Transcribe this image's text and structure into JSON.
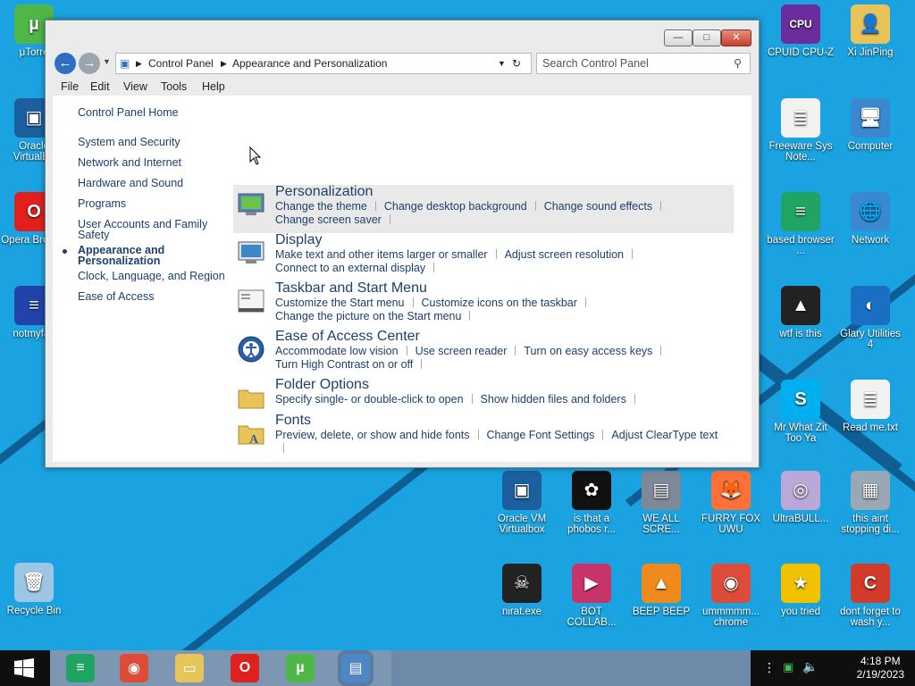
{
  "colors": {
    "accent": "#1aa3e0",
    "link": "#1d3f6e"
  },
  "window": {
    "buttons": {
      "minimize": "—",
      "maximize": "□",
      "close": "✕"
    },
    "breadcrumb": [
      "Control Panel",
      "Appearance and Personalization"
    ],
    "search_placeholder": "Search Control Panel",
    "menu": [
      "File",
      "Edit",
      "View",
      "Tools",
      "Help"
    ]
  },
  "nav": {
    "home": "Control Panel Home",
    "items": [
      "System and Security",
      "Network and Internet",
      "Hardware and Sound",
      "Programs",
      "User Accounts and Family Safety",
      "Appearance and Personalization",
      "Clock, Language, and Region",
      "Ease of Access"
    ],
    "active_index": 5
  },
  "categories": [
    {
      "title": "Personalization",
      "icon": "personalization-icon",
      "links": [
        "Change the theme",
        "Change desktop background",
        "Change sound effects",
        "Change screen saver"
      ]
    },
    {
      "title": "Display",
      "icon": "display-icon",
      "links": [
        "Make text and other items larger or smaller",
        "Adjust screen resolution",
        "Connect to an external display"
      ]
    },
    {
      "title": "Taskbar and Start Menu",
      "icon": "taskbar-icon",
      "links": [
        "Customize the Start menu",
        "Customize icons on the taskbar",
        "Change the picture on the Start menu"
      ]
    },
    {
      "title": "Ease of Access Center",
      "icon": "ease-of-access-icon",
      "links": [
        "Accommodate low vision",
        "Use screen reader",
        "Turn on easy access keys",
        "Turn High Contrast on or off"
      ]
    },
    {
      "title": "Folder Options",
      "icon": "folder-icon",
      "links": [
        "Specify single- or double-click to open",
        "Show hidden files and folders"
      ]
    },
    {
      "title": "Fonts",
      "icon": "fonts-icon",
      "links": [
        "Preview, delete, or show and hide fonts",
        "Change Font Settings",
        "Adjust ClearType text"
      ]
    }
  ],
  "desktop": [
    {
      "label": "μTorre",
      "icon": "utorrent-icon",
      "color": "#4fb748",
      "glyph": "µ"
    },
    {
      "label": "Oracle VirtualBo",
      "icon": "virtualbox-icon",
      "color": "#1c5f9e",
      "glyph": "▣"
    },
    {
      "label": "Opera Browse",
      "icon": "opera-icon",
      "color": "#e0201d",
      "glyph": "O"
    },
    {
      "label": "notmyfau",
      "icon": "bsod-icon",
      "color": "#2244aa",
      "glyph": "≡"
    },
    {
      "label": "Recycle Bin",
      "icon": "recycle-bin-icon",
      "color": "#9cc7e4",
      "glyph": "🗑"
    },
    {
      "label": "CPUID CPU-Z",
      "icon": "cpuz-icon",
      "color": "#6b2d9e",
      "glyph": "CPU"
    },
    {
      "label": "Xi JinPing",
      "icon": "user-folder-icon",
      "color": "#e8c35a",
      "glyph": "👤"
    },
    {
      "label": "Freeware Sys Note...",
      "icon": "text-file-icon",
      "color": "#f2f2f2",
      "glyph": "≣"
    },
    {
      "label": "Computer",
      "icon": "computer-icon",
      "color": "#3a89d0",
      "glyph": "🖥"
    },
    {
      "label": "based browser ...",
      "icon": "google-docs-icon",
      "color": "#1fa463",
      "glyph": "≡"
    },
    {
      "label": "Network",
      "icon": "network-icon",
      "color": "#3a89d0",
      "glyph": "🌐"
    },
    {
      "label": "wtf is this",
      "icon": "aimp-icon",
      "color": "#222",
      "glyph": "▲"
    },
    {
      "label": "Glary Utilities 4",
      "icon": "glary-icon",
      "color": "#1a6fc4",
      "glyph": "◐"
    },
    {
      "label": "Mr What Zit Too Ya",
      "icon": "skype-icon",
      "color": "#00aff0",
      "glyph": "S"
    },
    {
      "label": "Read me.txt",
      "icon": "text-file-icon",
      "color": "#f2f2f2",
      "glyph": "≣"
    },
    {
      "label": "Oracle VM Virtualbox",
      "icon": "virtualbox-icon",
      "color": "#1c5f9e",
      "glyph": "▣"
    },
    {
      "label": "is that a phobos r...",
      "icon": "icq-icon",
      "color": "#111",
      "glyph": "✿"
    },
    {
      "label": "WE ALL SCRE...",
      "icon": "computer-icon",
      "color": "#7d8898",
      "glyph": "▤"
    },
    {
      "label": "FURRY FOX UWU",
      "icon": "firefox-icon",
      "color": "#ff7139",
      "glyph": "🦊"
    },
    {
      "label": "UltraBULL...",
      "icon": "disc-icon",
      "color": "#b9a8d8",
      "glyph": "◎"
    },
    {
      "label": "this aint stopping di...",
      "icon": "installer-icon",
      "color": "#9aa7b5",
      "glyph": "▦"
    },
    {
      "label": "nirat.exe",
      "icon": "skull-icon",
      "color": "#222",
      "glyph": "☠"
    },
    {
      "label": "BOT COLLAB...",
      "icon": "film-icon",
      "color": "#c8336a",
      "glyph": "▶"
    },
    {
      "label": "BEEP BEEP",
      "icon": "vlc-icon",
      "color": "#f08a1c",
      "glyph": "▲"
    },
    {
      "label": "ummmmm... chrome",
      "icon": "chrome-icon",
      "color": "#dd4b39",
      "glyph": "◉"
    },
    {
      "label": "you tried",
      "icon": "star-icon",
      "color": "#f2c200",
      "glyph": "★"
    },
    {
      "label": "dont forget to wash y...",
      "icon": "ccleaner-icon",
      "color": "#d23a2a",
      "glyph": "C"
    }
  ],
  "taskbar": {
    "start": "windows-start-icon",
    "apps": [
      {
        "icon": "google-docs-icon",
        "color": "#1fa463",
        "glyph": "≡"
      },
      {
        "icon": "chrome-icon",
        "color": "#dd4b39",
        "glyph": "◉"
      },
      {
        "icon": "file-explorer-icon",
        "color": "#e6c65a",
        "glyph": "▭"
      },
      {
        "icon": "opera-icon",
        "color": "#e0201d",
        "glyph": "O"
      },
      {
        "icon": "utorrent-icon",
        "color": "#4fb748",
        "glyph": "µ"
      },
      {
        "icon": "control-panel-icon",
        "color": "#4f86c6",
        "glyph": "▤"
      }
    ],
    "time": "4:18 PM",
    "date": "2/19/2023"
  }
}
